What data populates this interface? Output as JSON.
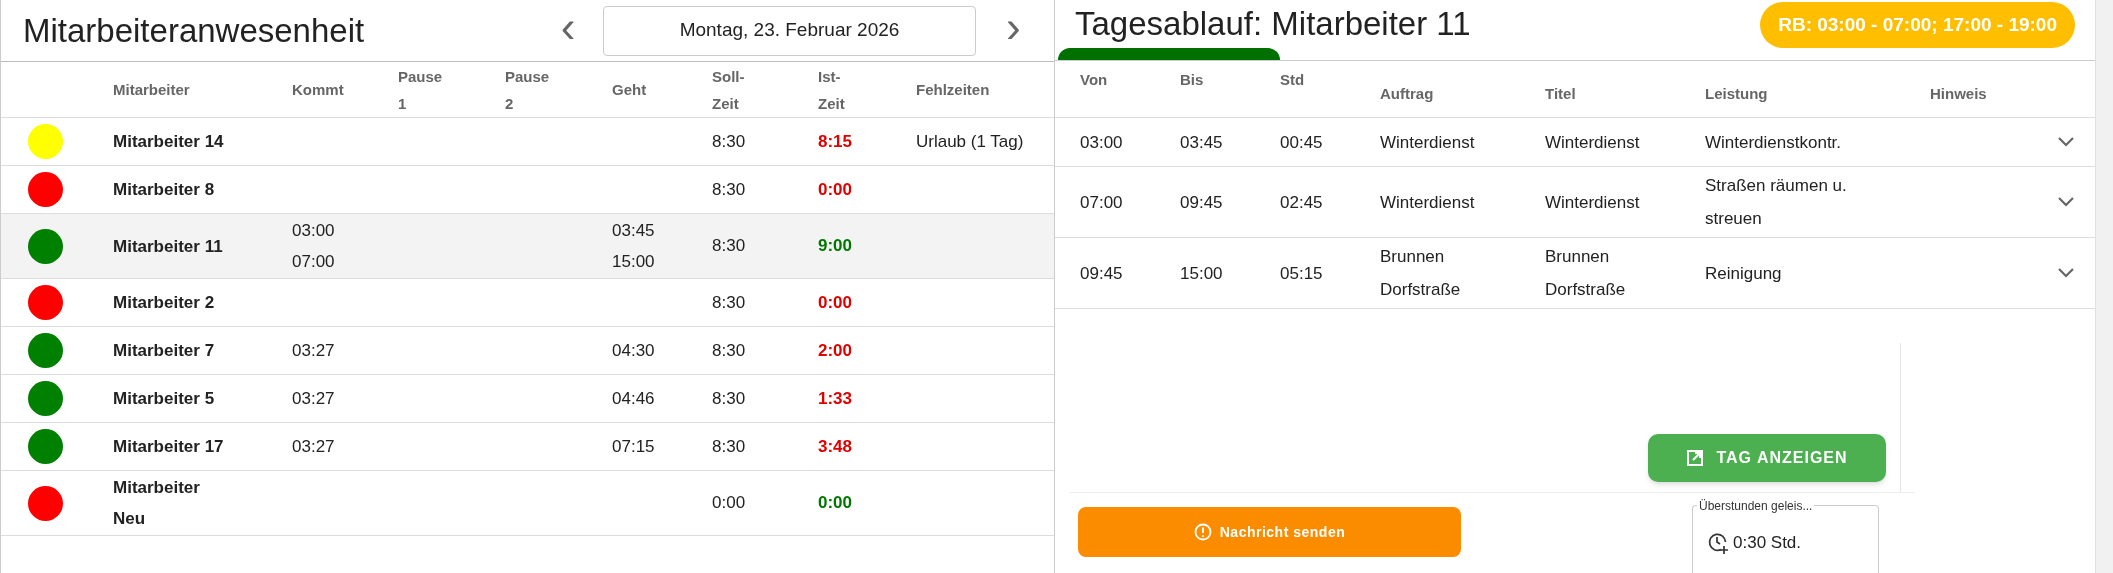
{
  "attendance": {
    "title": "Mitarbeiteranwesenheit",
    "date": "Montag, 23. Februar 2026",
    "prev": "‹",
    "next": "›",
    "columns": [
      "Mitarbeiter",
      "Kommt",
      "Pause 1",
      "Pause 2",
      "Geht",
      "Soll-Zeit",
      "Ist-Zeit",
      "Fehlzeiten"
    ],
    "rows": [
      {
        "name": "Mitarbeiter 14",
        "color": "#ffff00",
        "selected": false,
        "kommt": [],
        "geht": [],
        "soll": "8:30",
        "ist": {
          "value": "8:15",
          "color": "#e00000"
        },
        "fehlzeiten": "Urlaub (1 Tag)"
      },
      {
        "name": "Mitarbeiter 8",
        "color": "#ff0000",
        "selected": false,
        "kommt": [],
        "geht": [],
        "soll": "8:30",
        "ist": {
          "value": "0:00",
          "color": "#e00000"
        }
      },
      {
        "name": "Mitarbeiter 11",
        "color": "#008000",
        "selected": true,
        "kommt": [
          "03:00",
          "07:00"
        ],
        "geht": [
          "03:45",
          "15:00"
        ],
        "soll": "8:30",
        "ist": {
          "value": "9:00",
          "color": "#007800"
        }
      },
      {
        "name": "Mitarbeiter 2",
        "color": "#ff0000",
        "selected": false,
        "kommt": [],
        "geht": [],
        "soll": "8:30",
        "ist": {
          "value": "0:00",
          "color": "#e00000"
        }
      },
      {
        "name": "Mitarbeiter 7",
        "color": "#008000",
        "selected": false,
        "kommt": [
          "03:27"
        ],
        "geht": [
          "04:30"
        ],
        "soll": "8:30",
        "ist": {
          "value": "2:00",
          "color": "#e00000"
        }
      },
      {
        "name": "Mitarbeiter 5",
        "color": "#008000",
        "selected": false,
        "kommt": [
          "03:27"
        ],
        "geht": [
          "04:46"
        ],
        "soll": "8:30",
        "ist": {
          "value": "1:33",
          "color": "#e00000"
        }
      },
      {
        "name": "Mitarbeiter 17",
        "color": "#008000",
        "selected": false,
        "kommt": [
          "03:27"
        ],
        "geht": [
          "07:15"
        ],
        "soll": "8:30",
        "ist": {
          "value": "3:48",
          "color": "#e00000"
        }
      },
      {
        "name": "Mitarbeiter Neu",
        "color": "#ff0000",
        "selected": false,
        "kommt": [],
        "geht": [],
        "soll": "0:00",
        "ist": {
          "value": "0:00",
          "color": "#007800"
        }
      }
    ]
  },
  "schedule": {
    "title": "Tagesablauf: Mitarbeiter 11",
    "badge": "RB: 03:00 - 07:00; 17:00 - 19:00",
    "columns": [
      "Von",
      "Bis",
      "Std",
      "Auftrag",
      "Titel",
      "Leistung",
      "Hinweis"
    ],
    "rows": [
      {
        "von": "03:00",
        "bis": "03:45",
        "std": "00:45",
        "auftrag": "Winterdienst",
        "titel": "Winterdienst",
        "leistung": "Winterdienstkontr.",
        "expanded": false
      },
      {
        "von": "07:00",
        "bis": "09:45",
        "std": "02:45",
        "auftrag": "Winterdienst",
        "titel": "Winterdienst",
        "leistung": "Straßen räumen u. streuen",
        "expanded": false
      },
      {
        "von": "09:45",
        "bis": "15:00",
        "std": "05:15",
        "auftrag": "Brunnen Dorfstraße",
        "titel": "Brunnen Dorfstraße",
        "leistung": "Reinigung",
        "expanded": false
      }
    ],
    "show_day_button": "TAG ANZEIGEN",
    "message_button": "Nachricht senden",
    "overtime": {
      "label": "Überstunden geleis...",
      "value": "0:30 Std."
    }
  }
}
